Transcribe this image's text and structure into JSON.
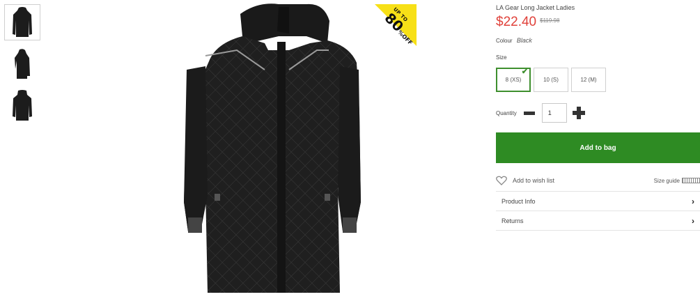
{
  "product": {
    "title": "LA Gear Long Jacket Ladies",
    "price": "$22.40",
    "was_price": "$119.98",
    "colour_label": "Colour",
    "colour_value": "Black"
  },
  "badge": {
    "top": "UP TO",
    "big": "80",
    "pct": "%",
    "off": "OFF",
    "color": "#f7e017"
  },
  "size": {
    "label": "Size",
    "options": [
      "8 (XS)",
      "10 (S)",
      "12 (M)"
    ],
    "selected": "8 (XS)"
  },
  "quantity": {
    "label": "Quantity",
    "value": "1"
  },
  "actions": {
    "add_to_bag": "Add to bag",
    "wish_list": "Add to wish list",
    "size_guide": "Size guide"
  },
  "accordion": [
    {
      "label": "Product Info"
    },
    {
      "label": "Returns"
    }
  ],
  "colors": {
    "accent": "#2e8b23",
    "price": "#e0413a"
  }
}
